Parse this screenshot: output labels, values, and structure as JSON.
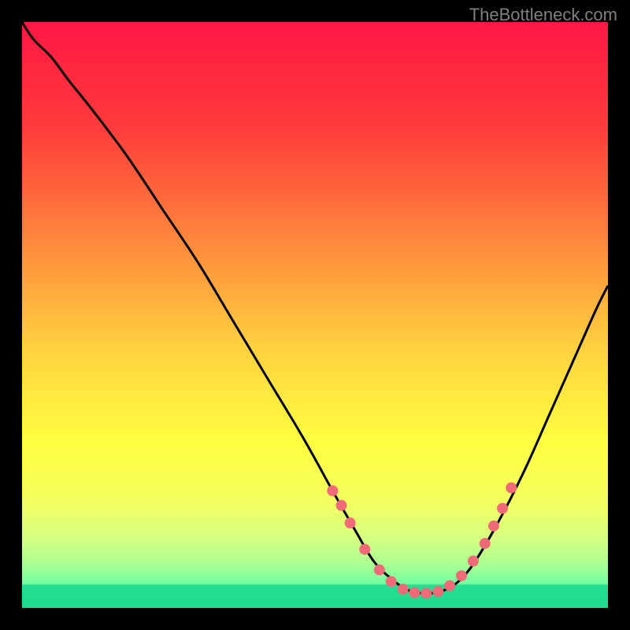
{
  "watermark": "TheBottleneck.com",
  "chart_data": {
    "type": "line",
    "title": "",
    "xlabel": "",
    "ylabel": "",
    "xlim": [
      0,
      100
    ],
    "ylim": [
      0,
      100
    ],
    "gradient_background": {
      "type": "vertical",
      "stops": [
        {
          "pos": 0.0,
          "color": "#ff1744"
        },
        {
          "pos": 0.18,
          "color": "#ff3b3b"
        },
        {
          "pos": 0.38,
          "color": "#ff8a3c"
        },
        {
          "pos": 0.55,
          "color": "#ffcf3f"
        },
        {
          "pos": 0.72,
          "color": "#ffff40"
        },
        {
          "pos": 0.82,
          "color": "#f2ff5f"
        },
        {
          "pos": 0.88,
          "color": "#d6ff80"
        },
        {
          "pos": 0.92,
          "color": "#b0ff90"
        },
        {
          "pos": 0.955,
          "color": "#7affa0"
        },
        {
          "pos": 0.978,
          "color": "#40e6a0"
        },
        {
          "pos": 1.0,
          "color": "#26d68d"
        }
      ]
    },
    "series": [
      {
        "name": "curve",
        "type": "line",
        "color": "#000000",
        "x": [
          0,
          2,
          5,
          8,
          12,
          18,
          24,
          30,
          36,
          42,
          48,
          53,
          57,
          60,
          63,
          66,
          69,
          72,
          75,
          78,
          82,
          86,
          90,
          94,
          98,
          100
        ],
        "y": [
          100,
          97,
          94,
          90,
          85,
          77,
          68,
          59,
          49,
          39,
          29,
          20,
          13,
          8,
          5,
          3,
          2.5,
          3,
          5,
          9,
          16,
          24,
          33,
          42,
          51,
          55
        ]
      },
      {
        "name": "markers",
        "type": "scatter",
        "color": "#f06a78",
        "marker_radius": 7,
        "x": [
          53,
          54.5,
          56,
          58.5,
          61,
          63,
          65,
          67,
          69,
          71,
          73,
          75,
          77,
          79,
          80.5,
          82,
          83.5
        ],
        "y": [
          20,
          17.5,
          14.5,
          10,
          6.5,
          4.5,
          3.2,
          2.6,
          2.5,
          2.8,
          3.8,
          5.5,
          8,
          11,
          14,
          17,
          20.5
        ]
      }
    ]
  }
}
